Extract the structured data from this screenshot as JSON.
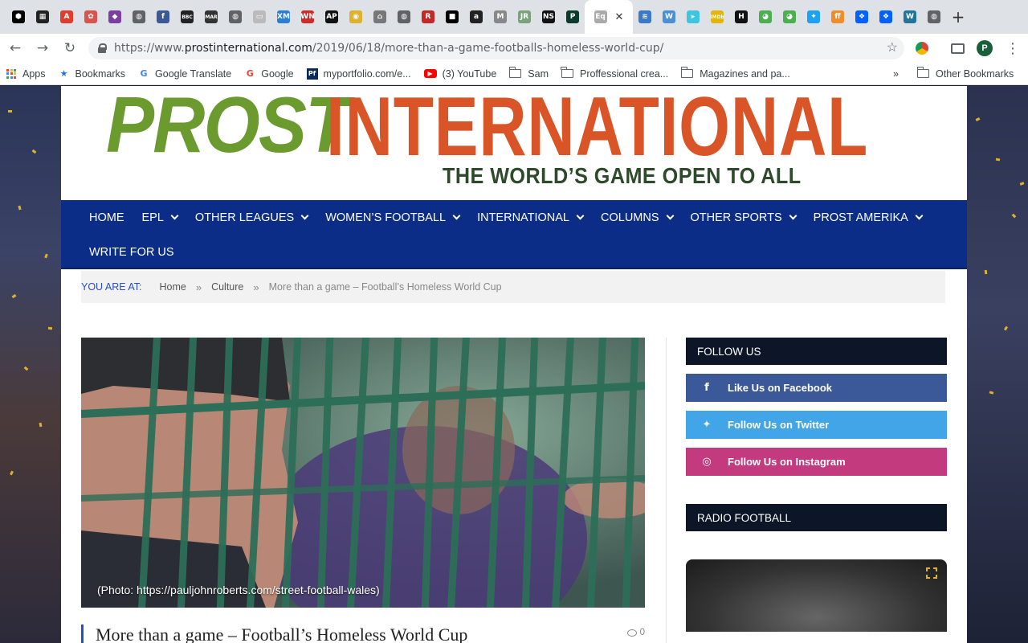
{
  "browser": {
    "tabs": [
      {
        "icon": "hexagon-icon",
        "glyph": "⬢",
        "color": "#000000"
      },
      {
        "icon": "news-icon",
        "glyph": "▦",
        "color": "#222222"
      },
      {
        "icon": "adobe-icon",
        "glyph": "A",
        "color": "#e03e2d"
      },
      {
        "icon": "bird-icon",
        "glyph": "✿",
        "color": "#d9534f"
      },
      {
        "icon": "gem-icon",
        "glyph": "◆",
        "color": "#7a3fa0"
      },
      {
        "icon": "globe-icon",
        "glyph": "◍",
        "color": "#5f6368"
      },
      {
        "icon": "facebook-icon",
        "glyph": "f",
        "color": "#3b5998"
      },
      {
        "icon": "bbc-icon",
        "glyph": "BBC",
        "color": "#222222"
      },
      {
        "icon": "mar-icon",
        "glyph": "MAR",
        "color": "#333333"
      },
      {
        "icon": "globe-icon",
        "glyph": "◍",
        "color": "#5f6368"
      },
      {
        "icon": "page-icon",
        "glyph": "▭",
        "color": "#bbbbbb"
      },
      {
        "icon": "xm-icon",
        "glyph": "XM",
        "color": "#2a7fd4"
      },
      {
        "icon": "wn-icon",
        "glyph": "WN",
        "color": "#d12a2a"
      },
      {
        "icon": "ap-icon",
        "glyph": "AP",
        "color": "#111111"
      },
      {
        "icon": "coin-icon",
        "glyph": "◉",
        "color": "#e0b12a"
      },
      {
        "icon": "house-icon",
        "glyph": "⌂",
        "color": "#777777"
      },
      {
        "icon": "globe-icon",
        "glyph": "◍",
        "color": "#5f6368"
      },
      {
        "icon": "r-icon",
        "glyph": "R",
        "color": "#c62828"
      },
      {
        "icon": "square-icon",
        "glyph": "■",
        "color": "#000000"
      },
      {
        "icon": "amazon-icon",
        "glyph": "a",
        "color": "#222222"
      },
      {
        "icon": "m-icon",
        "glyph": "M",
        "color": "#888888"
      },
      {
        "icon": "jr-icon",
        "glyph": "JR",
        "color": "#7aa37a"
      },
      {
        "icon": "ns-icon",
        "glyph": "NS",
        "color": "#111111"
      },
      {
        "icon": "p-icon",
        "glyph": "P",
        "color": "#0b3b2c"
      },
      {
        "icon": "eq-icon",
        "glyph": "Eq",
        "color": "#aaaaaa",
        "active": true
      },
      {
        "icon": "waves-icon",
        "glyph": "≋",
        "color": "#3a78c9"
      },
      {
        "icon": "w-icon",
        "glyph": "W",
        "color": "#4a90d9"
      },
      {
        "icon": "play-icon",
        "glyph": "▸",
        "color": "#3ec6e0"
      },
      {
        "icon": "imdb-icon",
        "glyph": "IMDb",
        "color": "#e5b50c"
      },
      {
        "icon": "h-icon",
        "glyph": "H",
        "color": "#111111"
      },
      {
        "icon": "chrome-icon",
        "glyph": "◕",
        "color": "#4caf50"
      },
      {
        "icon": "chrome-icon",
        "glyph": "◕",
        "color": "#4caf50"
      },
      {
        "icon": "twitter-icon",
        "glyph": "✦",
        "color": "#1da1f2"
      },
      {
        "icon": "ff-icon",
        "glyph": "ff",
        "color": "#f28c28"
      },
      {
        "icon": "dropbox-icon",
        "glyph": "❖",
        "color": "#0061fe"
      },
      {
        "icon": "dropbox-icon",
        "glyph": "❖",
        "color": "#0061fe"
      },
      {
        "icon": "wordpress-icon",
        "glyph": "W",
        "color": "#21759b"
      },
      {
        "icon": "globe-icon",
        "glyph": "◍",
        "color": "#5f6368"
      }
    ],
    "url_scheme": "https://www.",
    "url_host": "prostinternational.com",
    "url_path": "/2019/06/18/more-than-a-game-footballs-homeless-world-cup/",
    "profile_initial": "P",
    "bookmarks": [
      {
        "type": "apps",
        "label": "Apps"
      },
      {
        "type": "star",
        "label": "Bookmarks"
      },
      {
        "type": "translate",
        "label": "Google Translate"
      },
      {
        "type": "google",
        "label": "Google"
      },
      {
        "type": "pf",
        "label": "myportfolio.com/e..."
      },
      {
        "type": "youtube",
        "label": "(3) YouTube"
      },
      {
        "type": "folder",
        "label": "Sam"
      },
      {
        "type": "folder",
        "label": "Proffessional crea..."
      },
      {
        "type": "folder",
        "label": "Magazines and pa..."
      }
    ],
    "overflow_glyph": "»",
    "other_bookmarks": "Other Bookmarks"
  },
  "site": {
    "logo_part1": "PROST",
    "logo_part2": "INTERNATIONAL",
    "tagline": "THE WORLD’S GAME OPEN TO ALL",
    "colors": {
      "nav_bg": "#0b2d87",
      "logo_green": "#6b9a2e",
      "logo_orange": "#d95427",
      "accent": "#2950c2"
    },
    "nav_row1": [
      "HOME",
      "EPL",
      "OTHER LEAGUES",
      "WOMEN’S FOOTBALL",
      "INTERNATIONAL",
      "COLUMNS",
      "OTHER SPORTS",
      "PROST AMERIKA"
    ],
    "nav_row2": [
      "WRITE FOR US"
    ],
    "nav_has_dropdown": [
      false,
      true,
      true,
      true,
      true,
      true,
      true,
      true
    ],
    "breadcrumb": {
      "label": "YOU ARE AT:",
      "home": "Home",
      "category": "Culture",
      "current": "More than a game – Football’s Homeless World Cup",
      "separator": "»"
    },
    "article": {
      "photo_caption": "(Photo: https://pauljohnroberts.com/street-football-wales)",
      "title": "More than a game – Football’s Homeless World Cup",
      "comment_count": "0"
    },
    "sidebar": {
      "follow_heading": "FOLLOW US",
      "socials": [
        {
          "label": "Like Us on Facebook",
          "icon": "facebook-icon",
          "glyph": "f",
          "color": "#3b5998"
        },
        {
          "label": "Follow Us on Twitter",
          "icon": "twitter-icon",
          "glyph": "✦",
          "color": "#42a5e8"
        },
        {
          "label": "Follow Us on Instagram",
          "icon": "instagram-icon",
          "glyph": "◎",
          "color": "#c33b7e"
        }
      ],
      "radio_heading": "RADIO FOOTBALL"
    }
  }
}
